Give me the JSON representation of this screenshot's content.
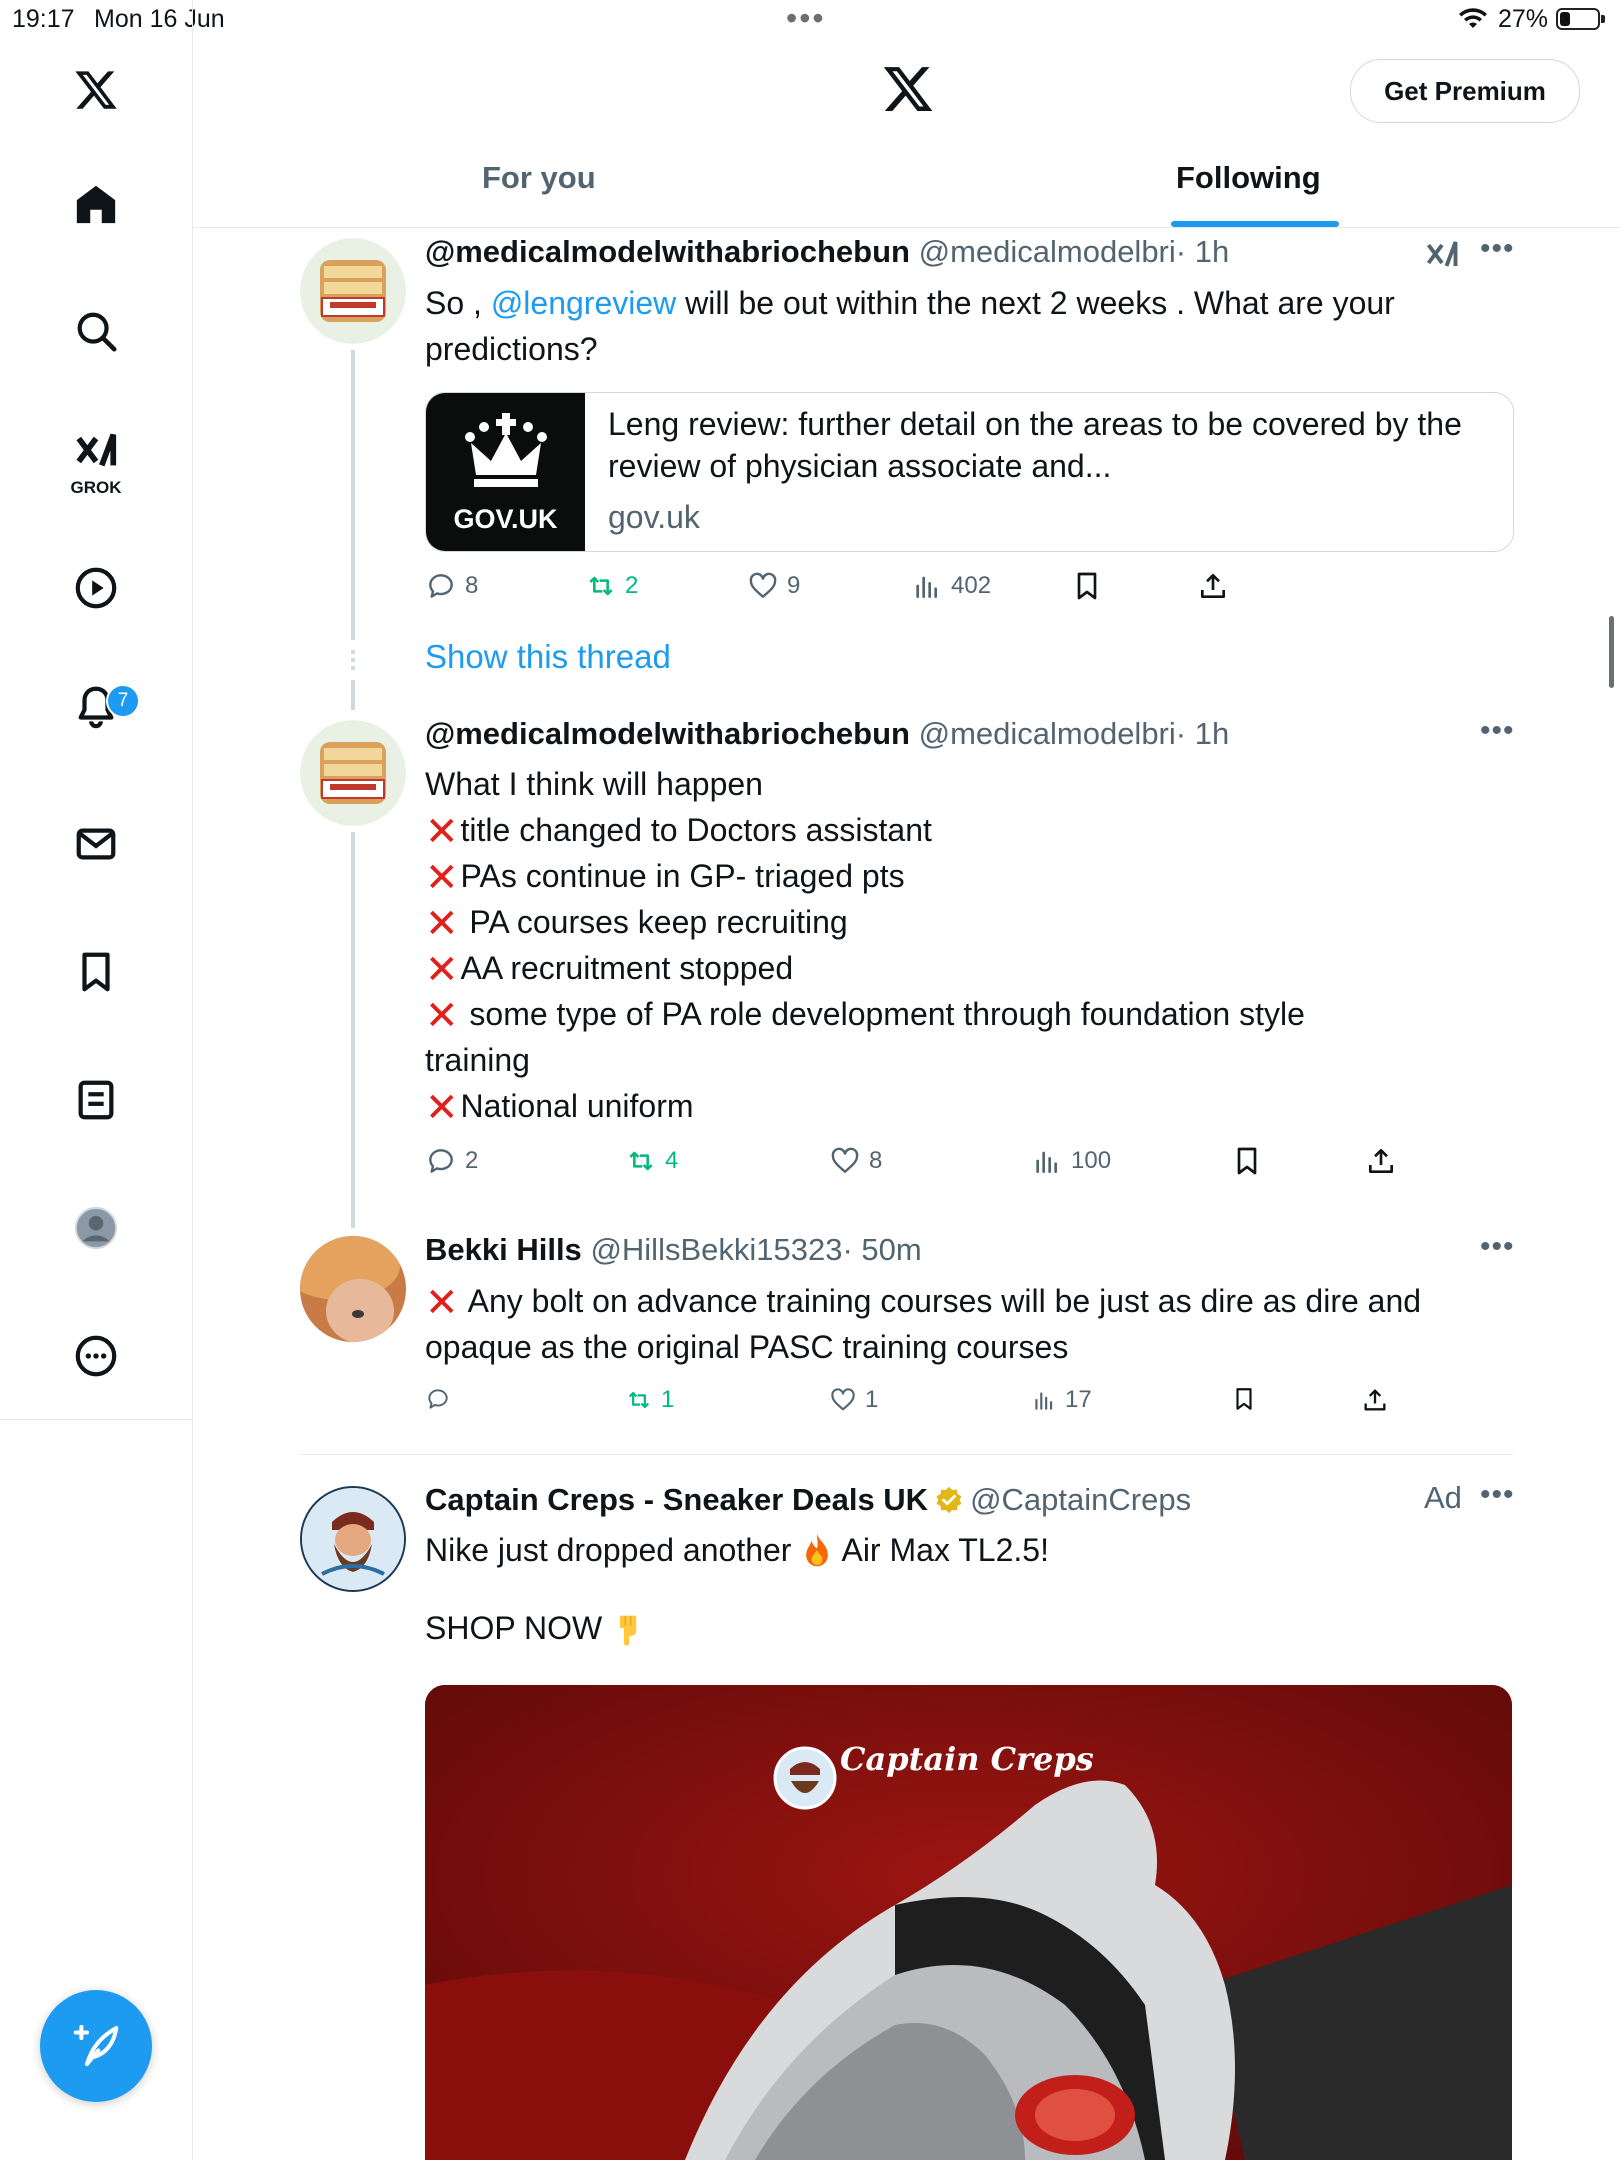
{
  "status_bar": {
    "time": "19:17",
    "date": "Mon 16 Jun",
    "battery": "27%",
    "battery_level": 0.27
  },
  "sidebar": {
    "grok_label": "GROK",
    "notifications_badge": "7"
  },
  "header": {
    "premium_button": "Get Premium"
  },
  "tabs": [
    {
      "label": "For you",
      "active": false
    },
    {
      "label": "Following",
      "active": true
    }
  ],
  "tweets": [
    {
      "name": "@medicalmodelwithabriochebun",
      "handle": "@medicalmodelbri",
      "time": "· 1h",
      "text_before": "So , ",
      "mention": "@lengreview",
      "text_after": "  will be out within the next 2 weeks . What are your predictions?",
      "card": {
        "thumb_label": "GOV.UK",
        "title": "Leng review: further detail on the areas to be covered by the review of physician associate and...",
        "domain": "gov.uk"
      },
      "stats": {
        "replies": "8",
        "reposts": "2",
        "likes": "9",
        "views": "402"
      }
    },
    {
      "name": "@medicalmodelwithabriochebun",
      "handle": "@medicalmodelbri",
      "time": "· 1h",
      "lines": [
        "What I think will happen",
        "title changed to Doctors assistant",
        "PAs continue in GP- triaged pts",
        " PA courses keep recruiting",
        "AA recruitment stopped",
        " some type of PA role development through foundation style",
        "training",
        "National uniform"
      ],
      "stats": {
        "replies": "2",
        "reposts": "4",
        "likes": "8",
        "views": "100"
      }
    },
    {
      "name": "Bekki Hills",
      "handle": "@HillsBekki15323",
      "time": "· 50m",
      "line1": " Any bolt on advance training courses will be just as dire as dire and",
      "line2": "opaque as the original PASC training courses",
      "stats": {
        "replies": "",
        "reposts": "1",
        "likes": "1",
        "views": "17"
      }
    },
    {
      "name": "Captain Creps - Sneaker Deals UK",
      "handle": "@CaptainCreps",
      "ad_label": "Ad",
      "line1_a": "Nike just dropped another ",
      "line1_b": " Air Max TL2.5!",
      "line2": "SHOP NOW ",
      "image_brand": "Captain Creps"
    }
  ],
  "show_thread": "Show this thread",
  "colors": {
    "accent": "#1d9bf0",
    "repost_green": "#00ba7c",
    "text": "#0f1419",
    "muted": "#536471",
    "cross_red": "#e0201b"
  }
}
